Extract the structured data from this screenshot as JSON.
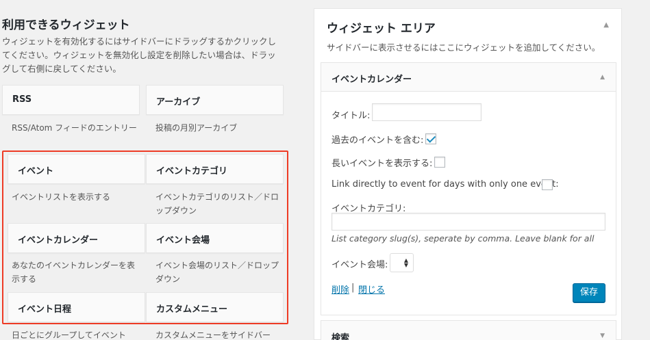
{
  "available": {
    "title": "利用できるウィジェット",
    "desc": "ウィジェットを有効化するにはサイドバーにドラッグするかクリックしてください。ウィジェットを無効化し設定を削除したい場合は、ドラッグして右側に戻してください。"
  },
  "widgets": [
    {
      "title": "RSS",
      "desc": "RSS/Atom フィードのエントリー"
    },
    {
      "title": "アーカイブ",
      "desc": "投稿の月別アーカイブ"
    },
    {
      "title": "イベント",
      "desc": "イベントリストを表示する"
    },
    {
      "title": "イベントカテゴリ",
      "desc": "イベントカテゴリのリスト／ドロップダウン"
    },
    {
      "title": "イベントカレンダー",
      "desc": "あなたのイベントカレンダーを表示する"
    },
    {
      "title": "イベント会場",
      "desc": "イベント会場のリスト／ドロップダウン"
    },
    {
      "title": "イベント日程",
      "desc": "日ごとにグループしてイベント"
    },
    {
      "title": "カスタムメニュー",
      "desc": "カスタムメニューをサイドバー"
    }
  ],
  "sidebar": {
    "title": "ウィジェット エリア",
    "desc": "サイドバーに表示させるにはここにウィジェットを追加してください。",
    "toggle": "▲"
  },
  "calendar_widget": {
    "title": "イベントカレンダー",
    "toggle": "▲",
    "title_label": "タイトル:",
    "title_value": "",
    "past_label": "過去のイベントを含む:",
    "past_checked": true,
    "long_label": "長いイベントを表示する:",
    "long_checked": false,
    "link_label": "Link directly to event for days with only one event:",
    "link_checked": false,
    "category_label": "イベントカテゴリ:",
    "category_value": "",
    "category_hint": "List category slug(s), seperate by comma. Leave blank for all",
    "venue_label": "イベント会場:",
    "delete_link": "削除",
    "separator": "|",
    "close_link": "閉じる",
    "save_button": "保存"
  },
  "search_widget": {
    "title": "検索",
    "toggle": "▼"
  },
  "colors": {
    "highlight": "#ee3b25",
    "primary": "#0085ba",
    "link": "#0073aa"
  }
}
